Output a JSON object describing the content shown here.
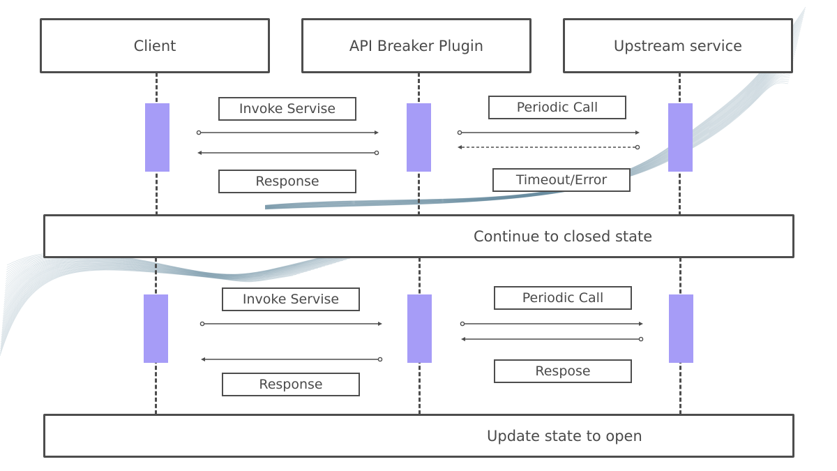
{
  "participants": [
    {
      "name": "Client"
    },
    {
      "name": "API Breaker Plugin"
    },
    {
      "name": "Upstream service"
    }
  ],
  "phase1": {
    "client_plugin": {
      "request": "Invoke Servise",
      "response": "Response"
    },
    "plugin_upstream": {
      "request": "Periodic Call",
      "response": "Timeout/Error",
      "response_style": "dashed"
    },
    "outcome": "Continue to closed state"
  },
  "phase2": {
    "client_plugin": {
      "request": "Invoke Servise",
      "response": "Response"
    },
    "plugin_upstream": {
      "request": "Periodic Call",
      "response": "Respose",
      "response_style": "solid"
    },
    "outcome": "Update state to open"
  },
  "colors": {
    "activation": "#a69cf7",
    "stroke": "#4d4d4d",
    "text": "#4a4a4a",
    "wave": "#2d5f7a"
  }
}
